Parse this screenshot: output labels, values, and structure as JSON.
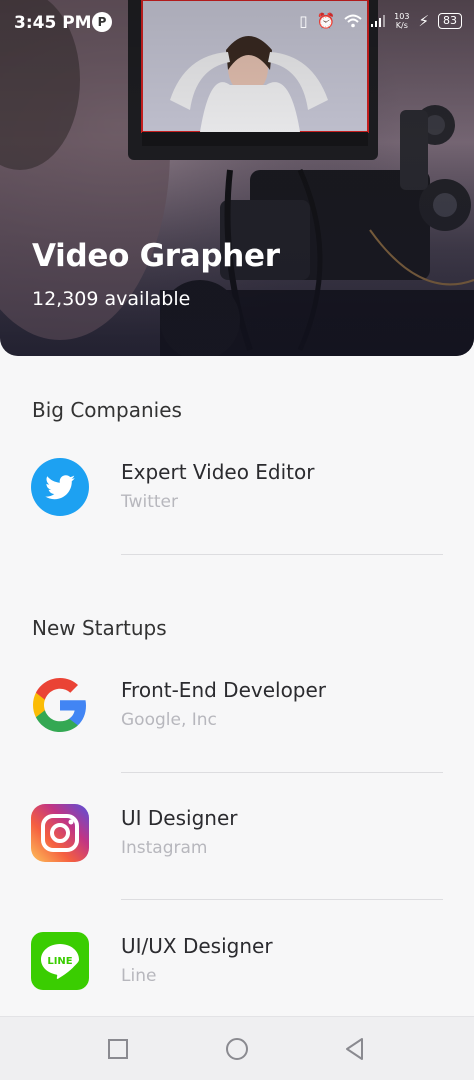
{
  "status_bar": {
    "time": "3:45 PM",
    "network_speed_value": "103",
    "network_speed_unit": "K/s",
    "battery": "83"
  },
  "hero": {
    "title": "Video Grapher",
    "subtitle": "12,309 available"
  },
  "sections": [
    {
      "title": "Big Companies",
      "items": [
        {
          "title": "Expert Video Editor",
          "company": "Twitter",
          "icon": "twitter-logo",
          "color": "#1da1f2"
        }
      ]
    },
    {
      "title": "New Startups",
      "items": [
        {
          "title": "Front-End Developer",
          "company": "Google, Inc",
          "icon": "google-logo",
          "color": "#4285f4"
        },
        {
          "title": "UI Designer",
          "company": "Instagram",
          "icon": "instagram-logo",
          "color": "#c13584"
        },
        {
          "title": "UI/UX Designer",
          "company": "Line",
          "icon": "line-logo",
          "color": "#3acd01"
        }
      ]
    }
  ],
  "nav": {
    "icons": [
      "recents-icon",
      "home-icon",
      "back-icon"
    ]
  }
}
